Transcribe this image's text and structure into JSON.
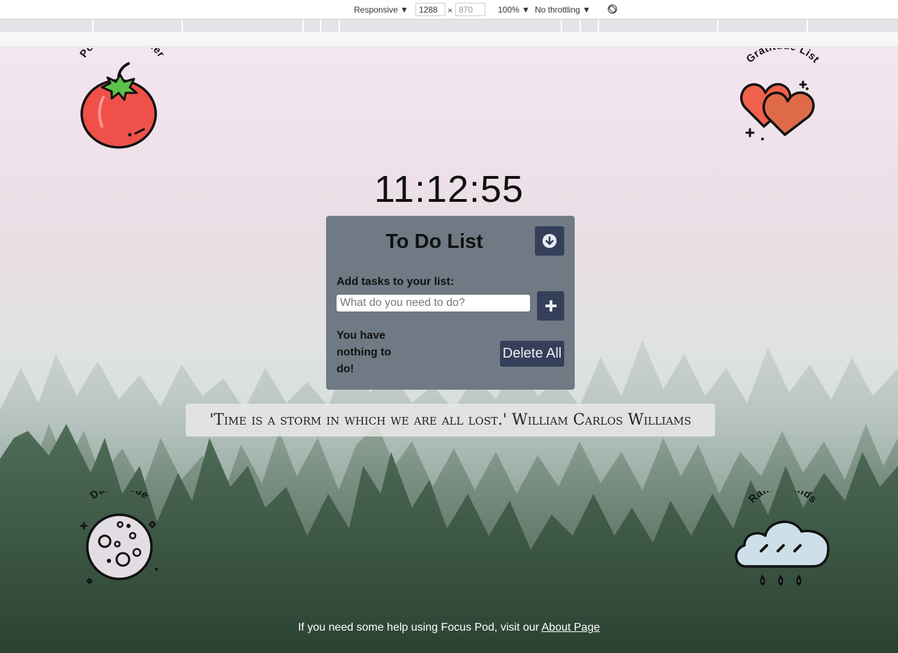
{
  "devtools": {
    "device": "Responsive",
    "width": "1288",
    "times": "×",
    "height": "870",
    "zoom": "100%",
    "throttling": "No throttling"
  },
  "icons": {
    "pomodoro_label": "Pomodoro Timer",
    "gratitude_label": "Gratitude List",
    "dark_mode_label": "Dark Mode",
    "rain_label": "Rain Sounds"
  },
  "clock": "11:12:55",
  "todo": {
    "title": "To Do List",
    "add_label": "Add tasks to your list:",
    "input_placeholder": "What do you need to do?",
    "input_value": "",
    "status": "You have nothing to do!",
    "delete_all": "Delete All"
  },
  "quote": "'Time is a storm in which we are all lost.' William Carlos Williams",
  "footer": {
    "text": "If you need some help using Focus Pod, visit our ",
    "link": "About Page"
  },
  "colors": {
    "panel": "#6f7a84",
    "button": "#353f5a",
    "tomato": "#f0504a",
    "heart": "#e8623f"
  }
}
